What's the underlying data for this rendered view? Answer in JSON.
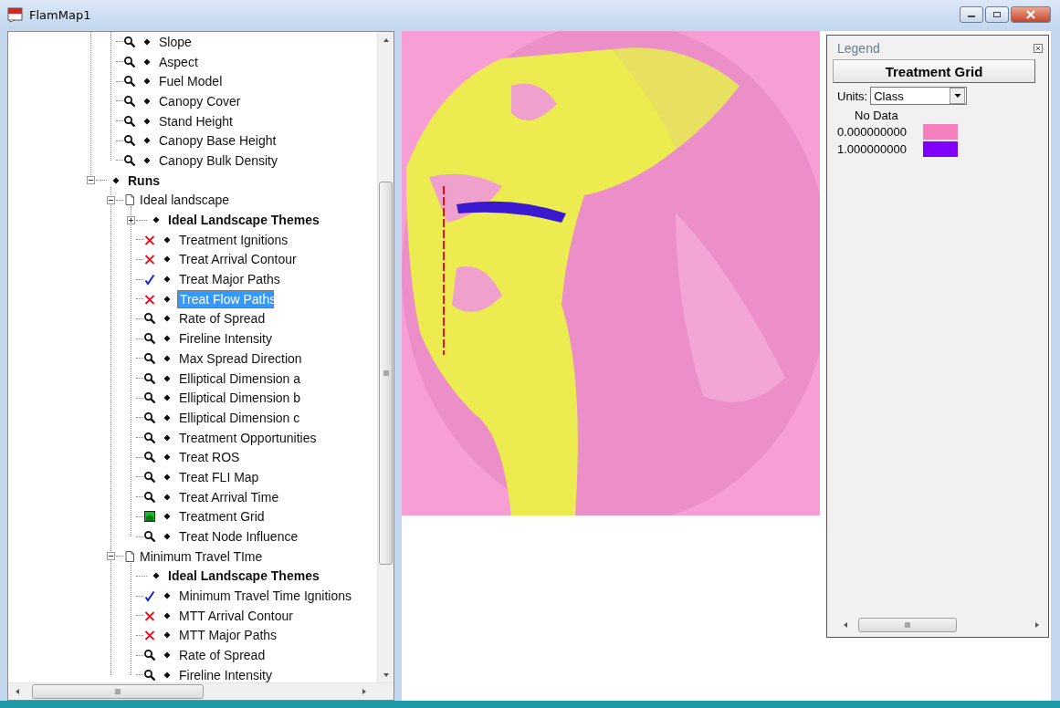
{
  "window": {
    "title": "FlamMap1"
  },
  "tree": {
    "continued_items": [
      {
        "label": "Slope",
        "kind": "magnifier",
        "bold": false,
        "selected": false
      },
      {
        "label": "Aspect",
        "kind": "magnifier",
        "bold": false,
        "selected": false
      },
      {
        "label": "Fuel Model",
        "kind": "magnifier",
        "bold": false,
        "selected": false
      },
      {
        "label": "Canopy Cover",
        "kind": "magnifier",
        "bold": false,
        "selected": false
      },
      {
        "label": "Stand Height",
        "kind": "magnifier",
        "bold": false,
        "selected": false
      },
      {
        "label": "Canopy Base Height",
        "kind": "magnifier",
        "bold": false,
        "selected": false
      },
      {
        "label": "Canopy Bulk Density",
        "kind": "magnifier",
        "bold": false,
        "selected": false
      }
    ],
    "items": [
      {
        "label": "Runs",
        "kind": "plain",
        "bold": true,
        "selected": false,
        "expanded": true,
        "children": [
          {
            "label": "Ideal landscape",
            "kind": "document",
            "bold": false,
            "selected": false,
            "expanded": true,
            "children": [
              {
                "label": "Ideal Landscape Themes",
                "kind": "plain",
                "bold": true,
                "selected": false,
                "expanded": false
              },
              {
                "label": "Treatment Ignitions",
                "kind": "cross",
                "bold": false,
                "selected": false
              },
              {
                "label": "Treat Arrival Contour",
                "kind": "cross",
                "bold": false,
                "selected": false
              },
              {
                "label": "Treat Major Paths",
                "kind": "check",
                "bold": false,
                "selected": false
              },
              {
                "label": "Treat Flow Paths",
                "kind": "cross",
                "bold": false,
                "selected": true
              },
              {
                "label": "Rate of Spread",
                "kind": "magnifier",
                "bold": false,
                "selected": false
              },
              {
                "label": "Fireline Intensity",
                "kind": "magnifier",
                "bold": false,
                "selected": false
              },
              {
                "label": "Max Spread Direction",
                "kind": "magnifier",
                "bold": false,
                "selected": false
              },
              {
                "label": "Elliptical Dimension a",
                "kind": "magnifier",
                "bold": false,
                "selected": false
              },
              {
                "label": "Elliptical Dimension b",
                "kind": "magnifier",
                "bold": false,
                "selected": false
              },
              {
                "label": "Elliptical Dimension c",
                "kind": "magnifier",
                "bold": false,
                "selected": false
              },
              {
                "label": "Treatment Opportunities",
                "kind": "magnifier",
                "bold": false,
                "selected": false
              },
              {
                "label": "Treat ROS",
                "kind": "magnifier",
                "bold": false,
                "selected": false
              },
              {
                "label": "Treat FLI Map",
                "kind": "magnifier",
                "bold": false,
                "selected": false
              },
              {
                "label": "Treat Arrival Time",
                "kind": "magnifier",
                "bold": false,
                "selected": false
              },
              {
                "label": "Treatment Grid",
                "kind": "grid",
                "bold": false,
                "selected": false
              },
              {
                "label": "Treat Node Influence",
                "kind": "magnifier",
                "bold": false,
                "selected": false
              }
            ]
          },
          {
            "label": "Minimum Travel TIme",
            "kind": "document",
            "bold": false,
            "selected": false,
            "expanded": true,
            "children": [
              {
                "label": "Ideal Landscape Themes",
                "kind": "plain",
                "bold": true,
                "selected": false
              },
              {
                "label": "Minimum Travel Time Ignitions",
                "kind": "check",
                "bold": false,
                "selected": false
              },
              {
                "label": "MTT Arrival Contour",
                "kind": "cross",
                "bold": false,
                "selected": false
              },
              {
                "label": "MTT Major Paths",
                "kind": "cross",
                "bold": false,
                "selected": false
              },
              {
                "label": "Rate of Spread",
                "kind": "magnifier",
                "bold": false,
                "selected": false
              },
              {
                "label": "Fireline Intensity",
                "kind": "magnifier",
                "bold": false,
                "selected": false
              }
            ]
          }
        ]
      }
    ]
  },
  "legend": {
    "title": "Legend",
    "layer_button": "Treatment Grid",
    "units_label": "Units:",
    "units_value": "Class",
    "no_data_label": "No Data",
    "classes": [
      {
        "value": "0.000000000",
        "color": "#f77fbe"
      },
      {
        "value": "1.000000000",
        "color": "#8000ff"
      }
    ]
  }
}
